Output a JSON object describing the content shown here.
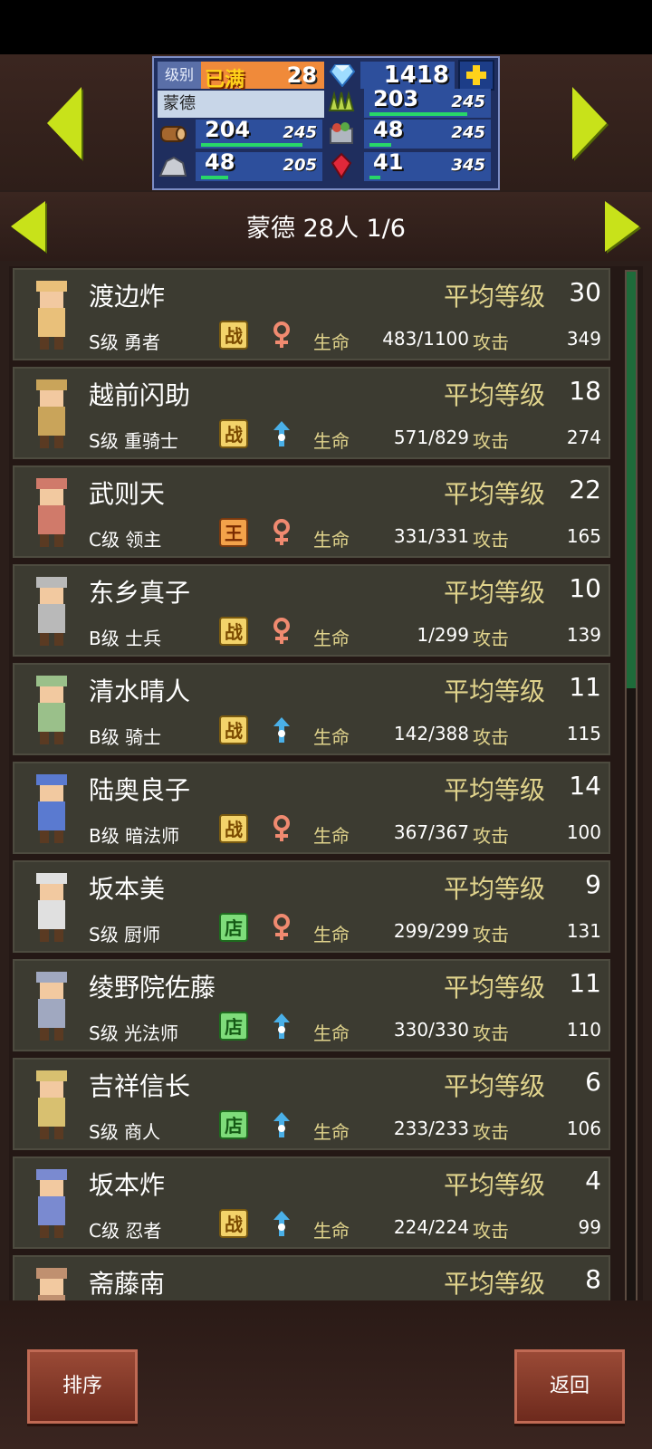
{
  "header": {
    "level_label": "级别",
    "level_badge": "已满",
    "level_value": "28",
    "town_name": "蒙德",
    "gems": "1418",
    "resources": [
      {
        "icon": "wood-icon",
        "value": "204",
        "max": "245",
        "fill": 0.83
      },
      {
        "icon": "stone-icon",
        "value": "48",
        "max": "205",
        "fill": 0.23
      },
      {
        "icon": "grass-icon",
        "value": "203",
        "max": "245",
        "fill": 0.83
      },
      {
        "icon": "food-icon",
        "value": "48",
        "max": "245",
        "fill": 0.2
      },
      {
        "icon": "ruby-icon",
        "value": "41",
        "max": "345",
        "fill": 0.12
      }
    ]
  },
  "subheader": {
    "title": "蒙德  28人 1/6"
  },
  "labels": {
    "avg_level": "平均等级",
    "hp": "生命",
    "atk": "攻击"
  },
  "characters": [
    {
      "name": "渡边炸",
      "avg_level": "30",
      "rank": "S级 勇者",
      "badge": "战",
      "badge_type": "zhan",
      "gender": "female",
      "hp": "483/1100",
      "atk": "349"
    },
    {
      "name": "越前闪助",
      "avg_level": "18",
      "rank": "S级 重骑士",
      "badge": "战",
      "badge_type": "zhan",
      "gender": "male",
      "hp": "571/829",
      "atk": "274"
    },
    {
      "name": "武则天",
      "avg_level": "22",
      "rank": "C级 领主",
      "badge": "王",
      "badge_type": "wang",
      "gender": "female",
      "hp": "331/331",
      "atk": "165"
    },
    {
      "name": "东乡真子",
      "avg_level": "10",
      "rank": "B级 士兵",
      "badge": "战",
      "badge_type": "zhan",
      "gender": "female",
      "hp": "1/299",
      "atk": "139"
    },
    {
      "name": "清水晴人",
      "avg_level": "11",
      "rank": "B级 骑士",
      "badge": "战",
      "badge_type": "zhan",
      "gender": "male",
      "hp": "142/388",
      "atk": "115"
    },
    {
      "name": "陆奥良子",
      "avg_level": "14",
      "rank": "B级 暗法师",
      "badge": "战",
      "badge_type": "zhan",
      "gender": "female",
      "hp": "367/367",
      "atk": "100"
    },
    {
      "name": "坂本美",
      "avg_level": "9",
      "rank": "S级 厨师",
      "badge": "店",
      "badge_type": "dian",
      "gender": "female",
      "hp": "299/299",
      "atk": "131"
    },
    {
      "name": "绫野院佐藤",
      "avg_level": "11",
      "rank": "S级 光法师",
      "badge": "店",
      "badge_type": "dian",
      "gender": "male",
      "hp": "330/330",
      "atk": "110"
    },
    {
      "name": "吉祥信长",
      "avg_level": "6",
      "rank": "S级 商人",
      "badge": "店",
      "badge_type": "dian",
      "gender": "male",
      "hp": "233/233",
      "atk": "106"
    },
    {
      "name": "坂本炸",
      "avg_level": "4",
      "rank": "C级 忍者",
      "badge": "战",
      "badge_type": "zhan",
      "gender": "male",
      "hp": "224/224",
      "atk": "99"
    },
    {
      "name": "斋藤南",
      "avg_level": "8",
      "rank": "",
      "badge": "",
      "badge_type": "",
      "gender": "",
      "hp": "",
      "atk": ""
    }
  ],
  "buttons": {
    "sort": "排序",
    "back": "返回"
  },
  "colors": {
    "accent_arrow": "#c8e21a",
    "panel_blue": "#2d4f9c",
    "gold_text": "#e0d38c",
    "bar_green": "#28d768"
  }
}
